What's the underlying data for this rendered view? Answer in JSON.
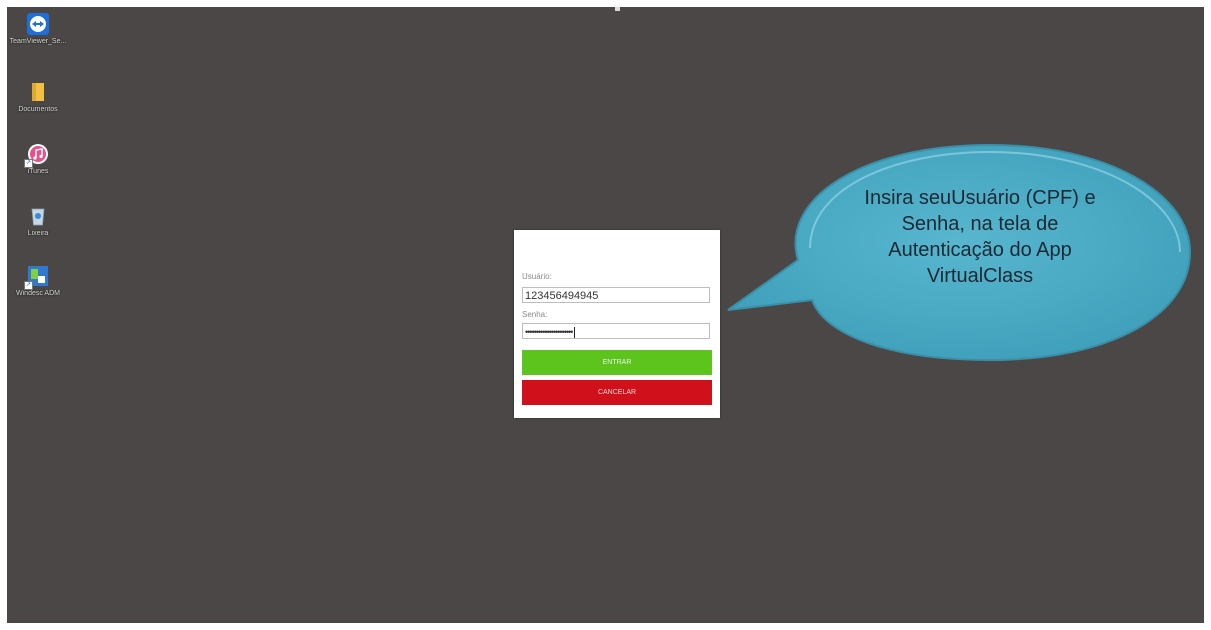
{
  "desktop": {
    "icons": [
      {
        "label": "TeamViewer_Se...",
        "icon": "teamviewer-icon"
      },
      {
        "label": "Documentos",
        "icon": "folder-icon"
      },
      {
        "label": "iTunes",
        "icon": "itunes-icon"
      },
      {
        "label": "Lixeira",
        "icon": "recycle-bin-icon"
      },
      {
        "label": "Windesc ADM",
        "icon": "app-shortcut-icon"
      }
    ]
  },
  "login": {
    "user_label": "Usuário:",
    "user_value": "123456494945",
    "password_label": "Senha:",
    "password_value": "••••••••••••••••••••••",
    "enter_label": "ENTRAR",
    "cancel_label": "CANCELAR"
  },
  "callout": {
    "line1": "Insira seuUsuário (CPF) e",
    "line2": "Senha, na tela de",
    "line3": "Autenticação do App",
    "line4": "VirtualClass"
  },
  "colors": {
    "desktop_bg": "#4a4746",
    "enter_button": "#5cc41d",
    "cancel_button": "#d0111c",
    "callout_fill": "#4bacc6"
  }
}
